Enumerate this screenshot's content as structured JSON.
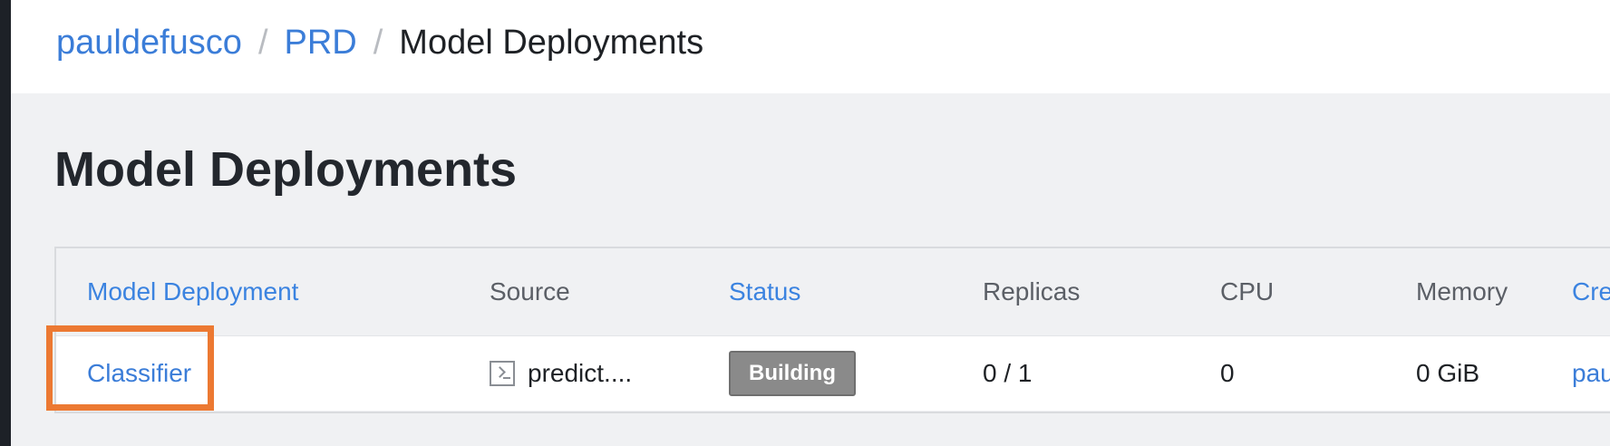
{
  "breadcrumb": {
    "items": [
      "pauldefusco",
      "PRD",
      "Model Deployments"
    ],
    "separator": "/"
  },
  "page": {
    "title": "Model Deployments"
  },
  "table": {
    "columns": [
      "Model Deployment",
      "Source",
      "Status",
      "Replicas",
      "CPU",
      "Memory",
      "Cre"
    ],
    "rows": [
      {
        "name": "Classifier",
        "source_icon": "terminal-icon",
        "source": "predict....",
        "status": "Building",
        "replicas": "0 / 1",
        "cpu": "0",
        "memory": "0 GiB",
        "created_by": "pau"
      }
    ]
  },
  "colors": {
    "link": "#3b7dd8",
    "status_building": "#8a8a8a",
    "highlight": "#ec7932"
  }
}
